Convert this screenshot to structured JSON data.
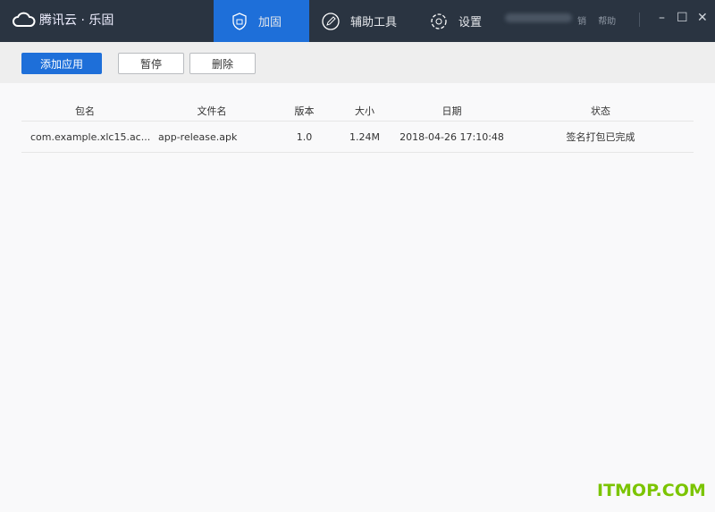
{
  "app": {
    "title": "腾讯云 · 乐固"
  },
  "nav": [
    {
      "label": "加固",
      "icon": "shield-lock-icon",
      "active": true
    },
    {
      "label": "辅助工具",
      "icon": "pen-circle-icon"
    },
    {
      "label": "设置",
      "icon": "gear-icon"
    }
  ],
  "header_links": {
    "logout": "销",
    "help": "帮助"
  },
  "window_controls": {
    "minimize": "–",
    "maximize": "☐",
    "close": "✕"
  },
  "toolbar": {
    "add": "添加应用",
    "pause": "暂停",
    "delete": "删除"
  },
  "table": {
    "columns": [
      "包名",
      "文件名",
      "版本",
      "大小",
      "日期",
      "状态"
    ],
    "rows": [
      [
        "com.example.xlc15.ac...",
        "app-release.apk",
        "1.0",
        "1.24M",
        "2018-04-26 17:10:48",
        "签名打包已完成"
      ]
    ]
  },
  "watermark": "ITMOP.COM",
  "colors": {
    "accent": "#1e6fd9",
    "header": "#2a3441"
  }
}
